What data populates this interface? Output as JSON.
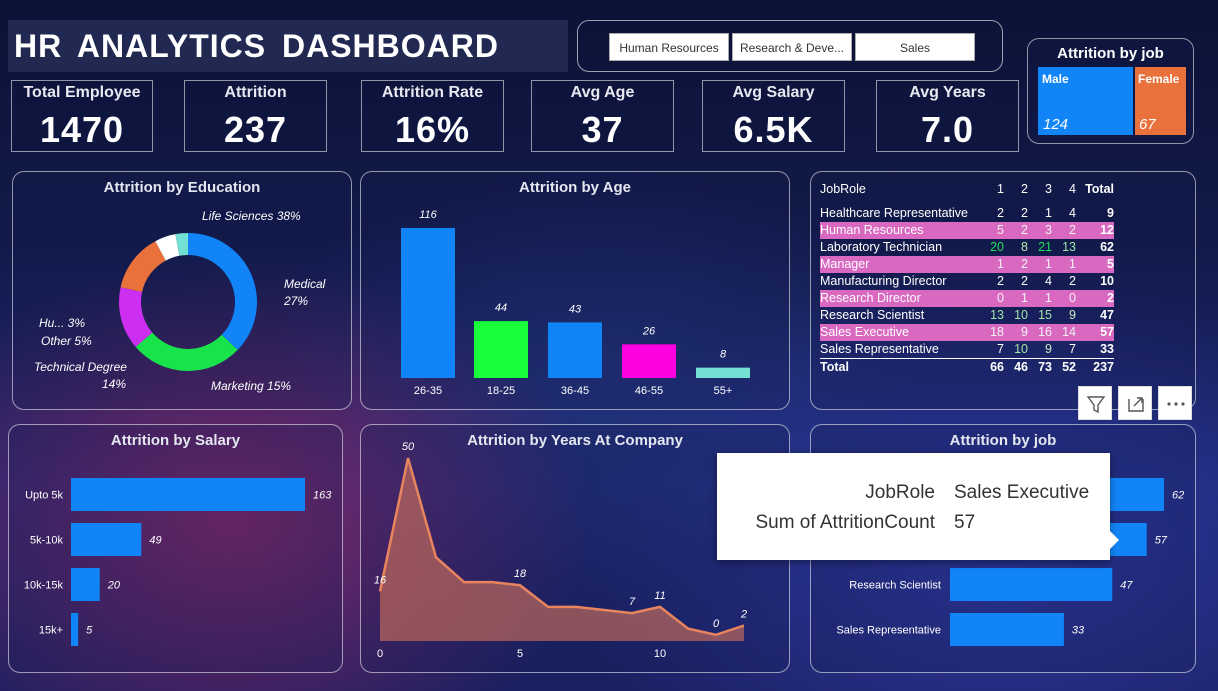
{
  "title": "HR  ANALYTICS  DASHBOARD",
  "slicer": [
    "Human Resources",
    "Research & Deve...",
    "Sales"
  ],
  "kpis": [
    {
      "label": "Total Employee",
      "value": "1470"
    },
    {
      "label": "Attrition",
      "value": "237"
    },
    {
      "label": "Attrition Rate",
      "value": "16%"
    },
    {
      "label": "Avg Age",
      "value": "37"
    },
    {
      "label": "Avg Salary",
      "value": "6.5K"
    },
    {
      "label": "Avg Years",
      "value": "7.0"
    }
  ],
  "gender": {
    "title": "Attrition by job",
    "male_label": "Male",
    "male_value": "124",
    "female_label": "Female",
    "female_value": "67",
    "colors": {
      "male": "#1185f7",
      "female": "#e8713c"
    }
  },
  "education": {
    "title": "Attrition by Education",
    "labels": [
      {
        "text": "Life Sciences 38%"
      },
      {
        "text": "Medical"
      },
      {
        "text": "27%"
      },
      {
        "text": "Marketing 15%"
      },
      {
        "text": "Technical Degree"
      },
      {
        "text": "14%"
      },
      {
        "text": "Other 5%"
      },
      {
        "text": "Hu... 3%"
      }
    ]
  },
  "age": {
    "title": "Attrition by Age"
  },
  "matrix": {
    "headers": [
      "JobRole",
      "1",
      "2",
      "3",
      "4",
      "Total"
    ],
    "rows": [
      {
        "name": "Healthcare Representative",
        "v": [
          "2",
          "2",
          "1",
          "4"
        ],
        "total": "9",
        "hl": false
      },
      {
        "name": "Human Resources",
        "v": [
          "5",
          "2",
          "3",
          "2"
        ],
        "total": "12",
        "hl": true
      },
      {
        "name": "Laboratory Technician",
        "v": [
          "20",
          "8",
          "21",
          "13"
        ],
        "total": "62",
        "hl": false
      },
      {
        "name": "Manager",
        "v": [
          "1",
          "2",
          "1",
          "1"
        ],
        "total": "5",
        "hl": true
      },
      {
        "name": "Manufacturing Director",
        "v": [
          "2",
          "2",
          "4",
          "2"
        ],
        "total": "10",
        "hl": false
      },
      {
        "name": "Research Director",
        "v": [
          "0",
          "1",
          "1",
          "0"
        ],
        "total": "2",
        "hl": true
      },
      {
        "name": "Research Scientist",
        "v": [
          "13",
          "10",
          "15",
          "9"
        ],
        "total": "47",
        "hl": false
      },
      {
        "name": "Sales Executive",
        "v": [
          "18",
          "9",
          "16",
          "14"
        ],
        "total": "57",
        "hl": true
      },
      {
        "name": "Sales Representative",
        "v": [
          "7",
          "10",
          "9",
          "7"
        ],
        "total": "33",
        "hl": false
      }
    ],
    "total": {
      "name": "Total",
      "v": [
        "66",
        "46",
        "73",
        "52"
      ],
      "total": "237"
    }
  },
  "salary": {
    "title": "Attrition by Salary"
  },
  "years": {
    "title": "Attrition by Years At Company"
  },
  "jobchart": {
    "title": "Attrition by job"
  },
  "tooltip": {
    "k1": "JobRole",
    "v1": "Sales Executive",
    "k2": "Sum of AttritionCount",
    "v2": "57"
  },
  "chart_data": [
    {
      "type": "pie",
      "title": "Attrition by Education",
      "categories": [
        "Life Sciences",
        "Medical",
        "Marketing",
        "Technical Degree",
        "Other",
        "Hu..."
      ],
      "values": [
        38,
        27,
        15,
        14,
        5,
        3
      ],
      "colors": [
        "#1185f7",
        "#19e34b",
        "#cc2ff0",
        "#e8713c",
        "#ffffff",
        "#72e0d2"
      ]
    },
    {
      "type": "bar",
      "title": "Attrition by Age",
      "categories": [
        "26-35",
        "18-25",
        "36-45",
        "46-55",
        "55+"
      ],
      "values": [
        116,
        44,
        43,
        26,
        8
      ],
      "colors": [
        "#1185f7",
        "#19ff3a",
        "#1185f7",
        "#ff00e0",
        "#72e0d2"
      ]
    },
    {
      "type": "bar",
      "title": "Attrition by Salary",
      "orientation": "horizontal",
      "categories": [
        "Upto 5k",
        "5k-10k",
        "10k-15k",
        "15k+"
      ],
      "values": [
        163,
        49,
        20,
        5
      ]
    },
    {
      "type": "area",
      "title": "Attrition by Years At Company",
      "x": [
        0,
        1,
        2,
        3,
        4,
        5,
        6,
        7,
        8,
        9,
        10,
        11,
        12,
        13
      ],
      "y": [
        16,
        59,
        27,
        19,
        19,
        18,
        11,
        11,
        10,
        9,
        11,
        4,
        2,
        5
      ],
      "labels": [
        {
          "x": 0,
          "text": "16"
        },
        {
          "x": 1,
          "text": "50"
        },
        {
          "x": 5,
          "text": "18"
        },
        {
          "x": 9,
          "text": "7"
        },
        {
          "x": 10,
          "text": "11"
        },
        {
          "x": 12,
          "text": "0"
        },
        {
          "x": 13,
          "text": "2"
        }
      ],
      "xticks": [
        "0",
        "5",
        "10"
      ]
    },
    {
      "type": "bar",
      "title": "Attrition by job",
      "orientation": "horizontal",
      "categories": [
        "",
        "",
        "Research Scientist",
        "Sales Representative"
      ],
      "values": [
        62,
        57,
        47,
        33
      ]
    }
  ]
}
